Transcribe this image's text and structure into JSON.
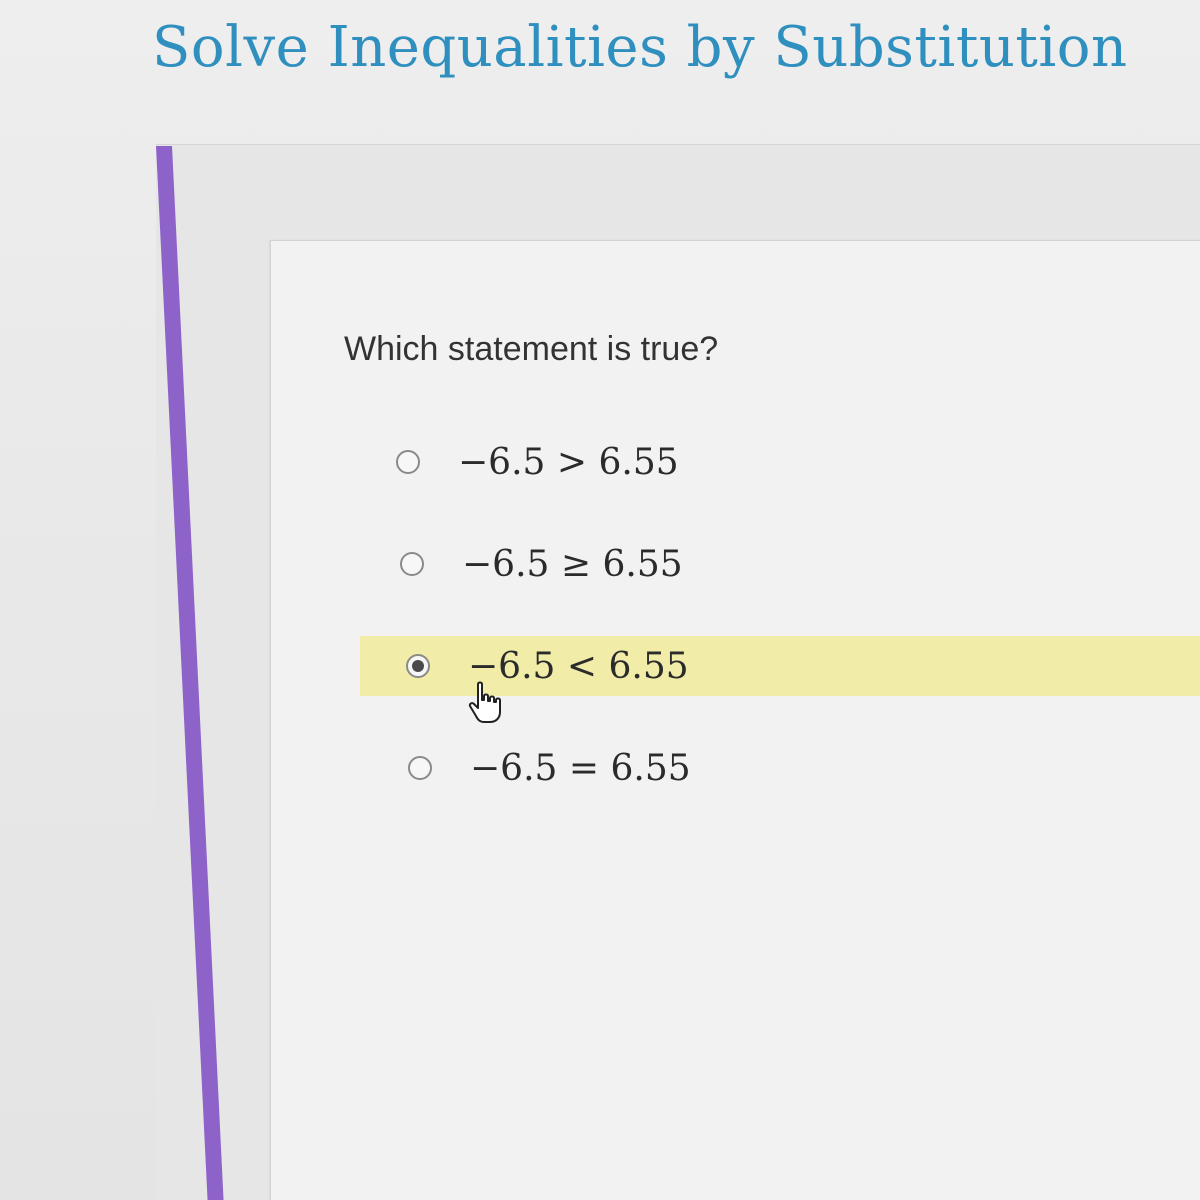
{
  "page": {
    "title": "Solve Inequalities by Substitution"
  },
  "question": {
    "prompt": "Which statement is true?",
    "options": [
      {
        "label": "−6.5 > 6.55",
        "selected": false
      },
      {
        "label": "−6.5 ≥ 6.55",
        "selected": false
      },
      {
        "label": "−6.5 < 6.55",
        "selected": true
      },
      {
        "label": "−6.5 = 6.55",
        "selected": false
      }
    ]
  },
  "colors": {
    "title": "#2f8fbf",
    "accent_bar": "#8e63c9",
    "selected_highlight": "#f1eca8"
  },
  "icons": {
    "cursor": "hand-pointer-icon"
  }
}
